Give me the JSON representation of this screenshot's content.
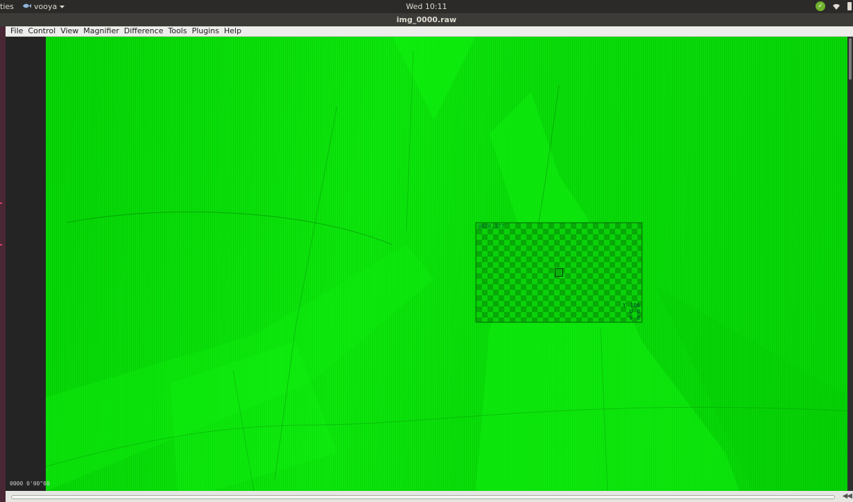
{
  "panel": {
    "activities": "ties",
    "app_name": "vooya",
    "clock": "Wed 10:11"
  },
  "window": {
    "title": "img_0000.raw"
  },
  "menu": {
    "items": [
      "File",
      "Control",
      "View",
      "Magnifier",
      "Difference",
      "Tools",
      "Plugins",
      "Help"
    ]
  },
  "magnifier": {
    "coords": "@820,377",
    "readout": [
      {
        "label": "Y",
        "value": "106"
      },
      {
        "label": "U",
        "value": "0"
      },
      {
        "label": "V",
        "value": "0"
      }
    ]
  },
  "status": {
    "frame_info": "0000  0'00\"00"
  },
  "seek": {
    "buttons": "◀◀"
  },
  "colors": {
    "image_green": "#0ce80c",
    "magnifier_dark": "#07a807",
    "tray_ok": "#6fb12d"
  },
  "icons": {
    "app": "fish-icon",
    "menu_arrow": "caret-down-icon",
    "tray": [
      "shield-check-icon",
      "wifi-icon",
      "power-icon"
    ]
  }
}
